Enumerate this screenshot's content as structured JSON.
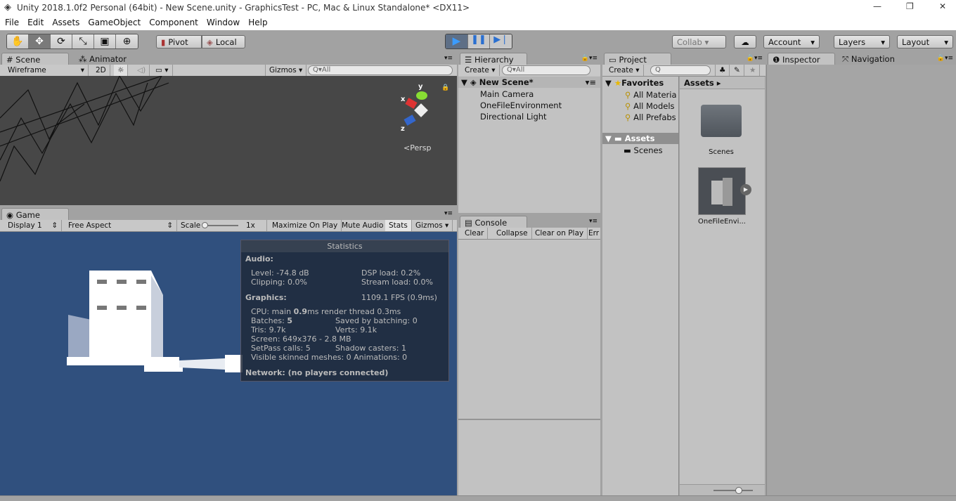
{
  "window": {
    "title": "Unity 2018.1.0f2 Personal (64bit) - New Scene.unity - GraphicsTest - PC, Mac & Linux Standalone* <DX11>",
    "minimize": "—",
    "maximize": "❐",
    "close": "✕"
  },
  "menu": [
    "File",
    "Edit",
    "Assets",
    "GameObject",
    "Component",
    "Window",
    "Help"
  ],
  "toolbar": {
    "tools": [
      "✋",
      "✥",
      "⟳",
      "⤡",
      "▣",
      "⊕"
    ],
    "pivot": "Pivot",
    "local": "Local",
    "collab": "Collab ▾",
    "account": "Account",
    "layers": "Layers",
    "layout": "Layout"
  },
  "scene": {
    "tabs": [
      "Scene",
      "Animator"
    ],
    "shading": "Wireframe",
    "mode2d": "2D",
    "gizmos": "Gizmos",
    "search_placeholder": "All",
    "persp": "Persp",
    "axes": {
      "x": "x",
      "y": "y",
      "z": "z"
    }
  },
  "game": {
    "tab": "Game",
    "display": "Display 1",
    "aspect": "Free Aspect",
    "scale_label": "Scale",
    "scale_value": "1x",
    "maximize": "Maximize On Play",
    "mute": "Mute Audio",
    "stats": "Stats",
    "gizmos": "Gizmos"
  },
  "statistics": {
    "title": "Statistics",
    "audio": "Audio:",
    "level": "Level: -74.8 dB",
    "dsp": "DSP load: 0.2%",
    "clipping": "Clipping: 0.0%",
    "stream": "Stream load: 0.0%",
    "graphics": "Graphics:",
    "fps": "1109.1 FPS (0.9ms)",
    "cpu_a": "CPU: main ",
    "cpu_b": "0.9",
    "cpu_c": "ms  render thread 0.3ms",
    "batches_a": "Batches: ",
    "batches_b": "5",
    "saved": "Saved by batching: 0",
    "tris": "Tris: 9.7k",
    "verts": "Verts: 9.1k",
    "screen": "Screen: 649x376 - 2.8 MB",
    "setpass": "SetPass calls: 5",
    "shadow": "Shadow casters: 1",
    "skinned": "Visible skinned meshes: 0  Animations: 0",
    "network": "Network: (no players connected)"
  },
  "hierarchy": {
    "tab": "Hierarchy",
    "create": "Create ▾",
    "search_placeholder": "All",
    "scene": "New Scene*",
    "items": [
      "Main Camera",
      "OneFileEnvironment",
      "Directional Light"
    ]
  },
  "console": {
    "tab": "Console",
    "buttons": [
      "Clear",
      "Collapse",
      "Clear on Play",
      "Err"
    ]
  },
  "project": {
    "tab": "Project",
    "create": "Create ▾",
    "favorites": "Favorites",
    "fav_items": [
      "All Materia",
      "All Models",
      "All Prefabs"
    ],
    "assets_root": "Assets",
    "assets_children": [
      "Scenes"
    ],
    "breadcrumb": "Assets ▸",
    "items": [
      "Scenes",
      "OneFileEnvi..."
    ]
  },
  "inspector": {
    "tabs": [
      "Inspector",
      "Navigation"
    ]
  },
  "colors": {
    "play_active": "#3b7fd8",
    "game_bg": "#30507e",
    "scene_bg": "#474747"
  }
}
